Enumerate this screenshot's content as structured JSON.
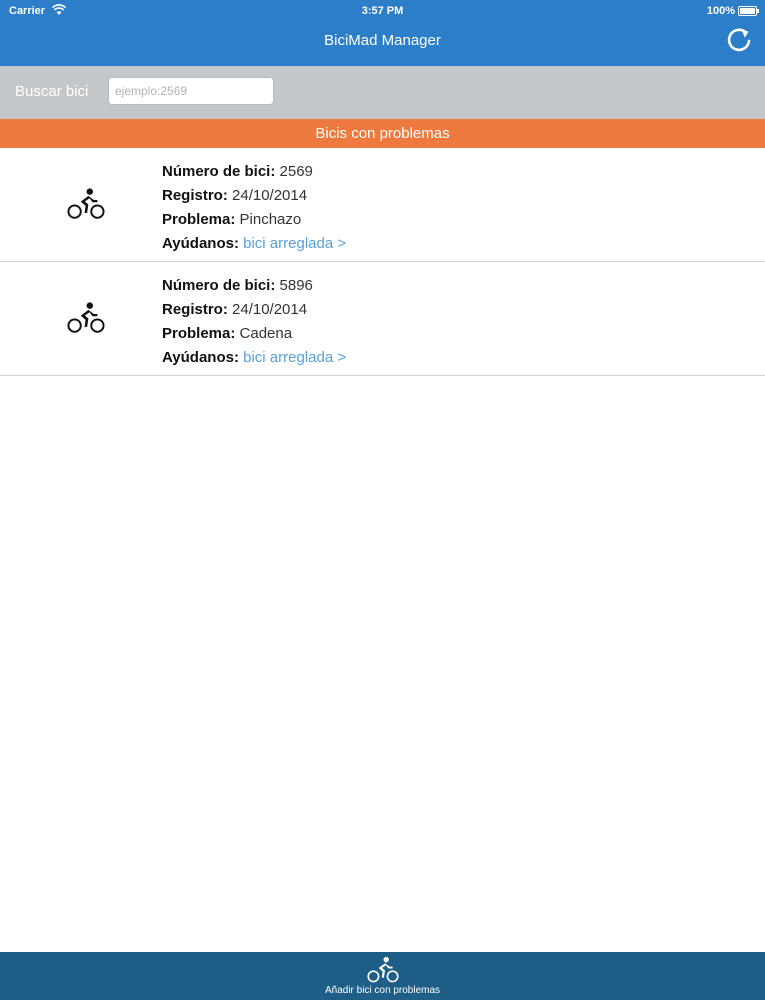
{
  "status_bar": {
    "carrier": "Carrier",
    "time": "3:57 PM",
    "battery": "100%",
    "battery_level": 1.0
  },
  "nav": {
    "title": "BiciMad Manager"
  },
  "search": {
    "label": "Buscar bici",
    "placeholder": "ejemplo:2569",
    "value": ""
  },
  "section": {
    "title": "Bicis con problemas"
  },
  "bikes": [
    {
      "number_label": "Número de bici:",
      "number": "2569",
      "registro_label": "Registro:",
      "registro": "24/10/2014",
      "problema_label": "Problema:",
      "problema": "Pinchazo",
      "ayuda_label": "Ayúdanos:",
      "link": "bici arreglada >",
      "icon": "cyclist-icon"
    },
    {
      "number_label": "Número de bici:",
      "number": "5896",
      "registro_label": "Registro:",
      "registro": "24/10/2014",
      "problema_label": "Problema:",
      "problema": "Cadena",
      "ayuda_label": "Ayúdanos:",
      "link": "bici arreglada >",
      "icon": "cyclist-icon"
    }
  ],
  "tabbar": {
    "label": "Añadir bici con problemas",
    "icon": "cyclist-icon"
  },
  "colors": {
    "nav_bar": "#2c7ec8",
    "search_bar": "#c4c7ca",
    "section_header": "#ee7a40",
    "tab_bar": "#1e5e87",
    "link": "#5aa0d8"
  }
}
